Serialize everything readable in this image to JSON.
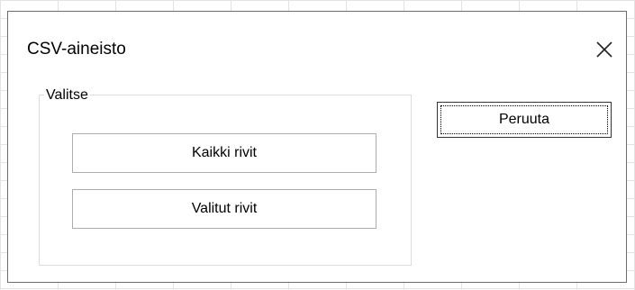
{
  "dialog": {
    "title": "CSV-aineisto",
    "close_icon": "close-icon"
  },
  "group": {
    "legend": "Valitse",
    "buttons": {
      "all_rows": "Kaikki rivit",
      "selected_rows": "Valitut rivit"
    }
  },
  "actions": {
    "cancel": "Peruuta"
  },
  "colors": {
    "dialog_border": "#6d6d6d",
    "button_border": "#adadad",
    "group_border": "#dcdcdc",
    "grid_line": "#e3e3e3"
  }
}
